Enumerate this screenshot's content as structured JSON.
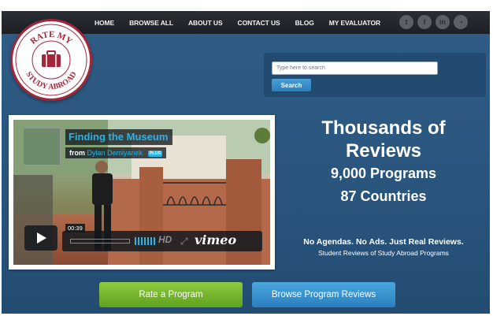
{
  "nav": {
    "items": [
      {
        "label": "HOME"
      },
      {
        "label": "BROWSE ALL"
      },
      {
        "label": "ABOUT US"
      },
      {
        "label": "CONTACT US"
      },
      {
        "label": "BLOG"
      },
      {
        "label": "MY EVALUATOR"
      }
    ],
    "social": [
      {
        "icon": "twitter-icon",
        "glyph": "t"
      },
      {
        "icon": "facebook-icon",
        "glyph": "f"
      },
      {
        "icon": "linkedin-icon",
        "glyph": "in"
      },
      {
        "icon": "rss-icon",
        "glyph": "◔"
      }
    ]
  },
  "logo": {
    "top_text": "RATE MY",
    "bottom_text": "STUDY ABROAD",
    "icon": "suitcase-icon",
    "color": "#a2273b"
  },
  "search": {
    "placeholder": "Type here to search",
    "button_label": "Search"
  },
  "video": {
    "title": "Finding the Museum",
    "from_label": "from",
    "author": "Dylan Demiyanek",
    "badge": "PLUS",
    "time": "00:39",
    "hd_label": "HD",
    "brand": "vimeo",
    "volume_level": 0.8,
    "progress": 0.0
  },
  "hero": {
    "headline_line1": "Thousands of",
    "headline_line2": "Reviews",
    "programs": "9,000 Programs",
    "countries": "87 Countries",
    "tagline": "No Agendas. No Ads. Just Real Reviews.",
    "subtagline": "Student Reviews of Study Abroad Programs"
  },
  "cta": {
    "rate_label": "Rate a Program",
    "browse_label": "Browse Program Reviews"
  },
  "colors": {
    "accent_blue": "#28b2e6",
    "green": "#6cb12a",
    "button_blue": "#3a93d0",
    "background": "#2c5a82"
  }
}
